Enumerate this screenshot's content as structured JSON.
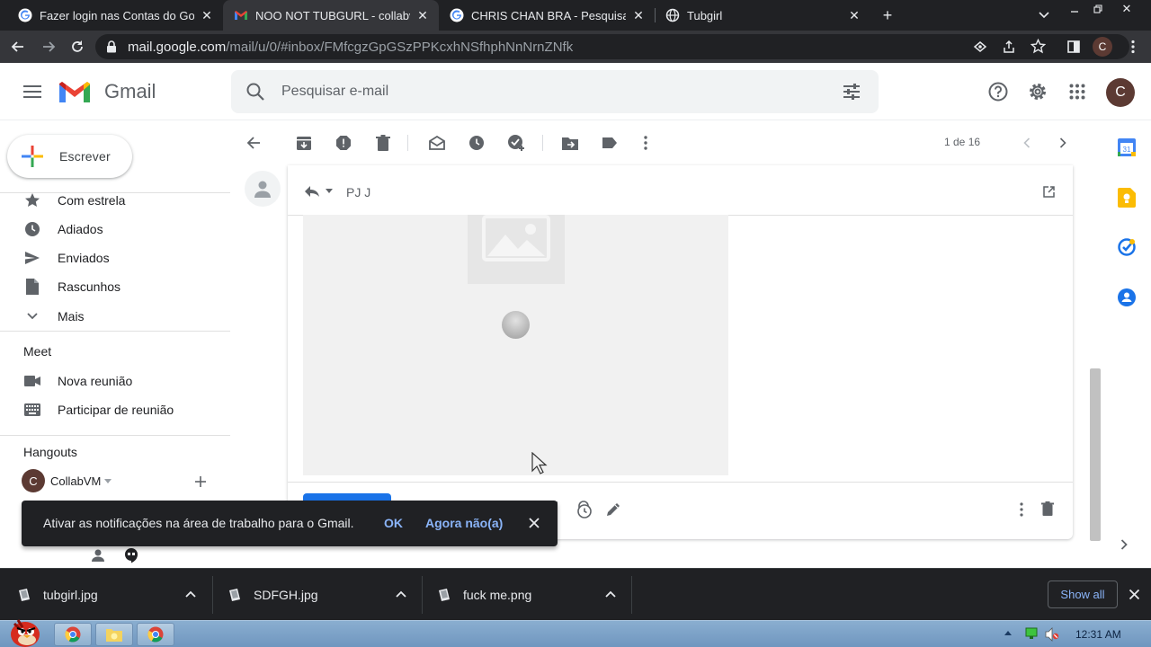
{
  "browser": {
    "tabs": [
      {
        "title": "Fazer login nas Contas do Google",
        "favicon": "google-g-icon",
        "active": false
      },
      {
        "title": "NOO NOT TUBGURL - collabvm",
        "favicon": "gmail-m-icon",
        "active": true
      },
      {
        "title": "CHRIS CHAN BRA - Pesquisa Google",
        "favicon": "google-g-icon",
        "active": false
      },
      {
        "title": "Tubgirl",
        "favicon": "globe-icon",
        "active": false
      }
    ],
    "url_host": "mail.google.com",
    "url_path": "/mail/u/0/#inbox/FMfcgzGpGSzPPKcxhNSfhphNnNrnZNfk",
    "profile_initial": "C"
  },
  "gmail": {
    "brand": "Gmail",
    "search_placeholder": "Pesquisar e-mail",
    "account_initial": "C",
    "compose_label": "Escrever",
    "nav": [
      {
        "label": "Com estrela",
        "icon": "star-icon"
      },
      {
        "label": "Adiados",
        "icon": "clock-icon"
      },
      {
        "label": "Enviados",
        "icon": "send-icon"
      },
      {
        "label": "Rascunhos",
        "icon": "draft-icon"
      },
      {
        "label": "Mais",
        "icon": "chevron-down-icon"
      }
    ],
    "meet": {
      "heading": "Meet",
      "items": [
        {
          "label": "Nova reunião",
          "icon": "videocam-icon"
        },
        {
          "label": "Participar de reunião",
          "icon": "keyboard-icon"
        }
      ]
    },
    "hangouts": {
      "heading": "Hangouts",
      "user_initial": "C",
      "user": "CollabVM"
    },
    "pagination": "1 de 16",
    "sender": "PJ J"
  },
  "toast": {
    "message": "Ativar as notificações na área de trabalho para o Gmail.",
    "ok": "OK",
    "later": "Agora não(a)"
  },
  "downloads": {
    "files": [
      "tubgirl.jpg",
      "SDFGH.jpg",
      "fuck me.png"
    ],
    "show_all": "Show all"
  },
  "taskbar": {
    "clock": "12:31 AM"
  },
  "colors": {
    "tab_strip": "#202124",
    "toolbar": "#35363a",
    "gmail_red": "#ea4335",
    "avatar": "#5c3a33",
    "link_blue": "#8ab4f8"
  }
}
